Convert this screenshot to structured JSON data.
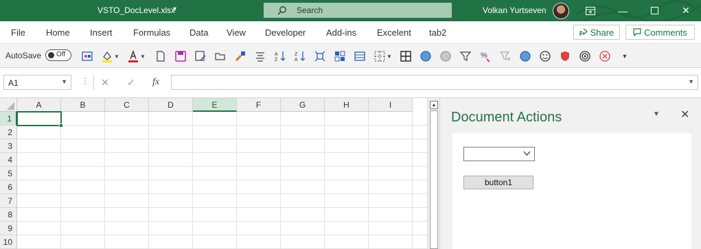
{
  "window": {
    "file_name": "VSTO_DocLevel.xlsx",
    "search_placeholder": "Search",
    "user_name": "Volkan Yurtseven",
    "brand_color": "#217346"
  },
  "ribbon": {
    "tabs": [
      "File",
      "Home",
      "Insert",
      "Formulas",
      "Data",
      "View",
      "Developer",
      "Add-ins",
      "Excelent",
      "tab2"
    ],
    "share_label": "Share",
    "comments_label": "Comments"
  },
  "quick_toolbar": {
    "autosave_label": "AutoSave",
    "autosave_state": "Off",
    "icons": [
      "sheet-icon",
      "fill-color-icon",
      "font-color-icon",
      "new-document-icon",
      "save-icon",
      "save-as-icon",
      "open-folder-icon",
      "format-painter-icon",
      "align-icon",
      "sort-ascending-icon",
      "sort-descending-icon",
      "fit-icon",
      "table-icon",
      "layout-icon",
      "borders-icon",
      "grid-icon",
      "circle-blue-icon",
      "circle-gray-icon",
      "filter-icon",
      "percent-icon",
      "clear-filter-icon",
      "circle-blue-2-icon",
      "smiley-icon",
      "shield-icon",
      "target-icon",
      "cancel-icon",
      "more-icon"
    ]
  },
  "formula_bar": {
    "name_box": "A1",
    "fx_label": "fx",
    "formula": ""
  },
  "sheet": {
    "columns": [
      "A",
      "B",
      "C",
      "D",
      "E",
      "F",
      "G",
      "H",
      "I"
    ],
    "rows": [
      "1",
      "2",
      "3",
      "4",
      "5",
      "6",
      "7",
      "8",
      "9",
      "10"
    ],
    "selected_cell": "A1",
    "highlighted_column": "E"
  },
  "document_actions": {
    "title": "Document Actions",
    "combo_value": "",
    "button_label": "button1"
  }
}
